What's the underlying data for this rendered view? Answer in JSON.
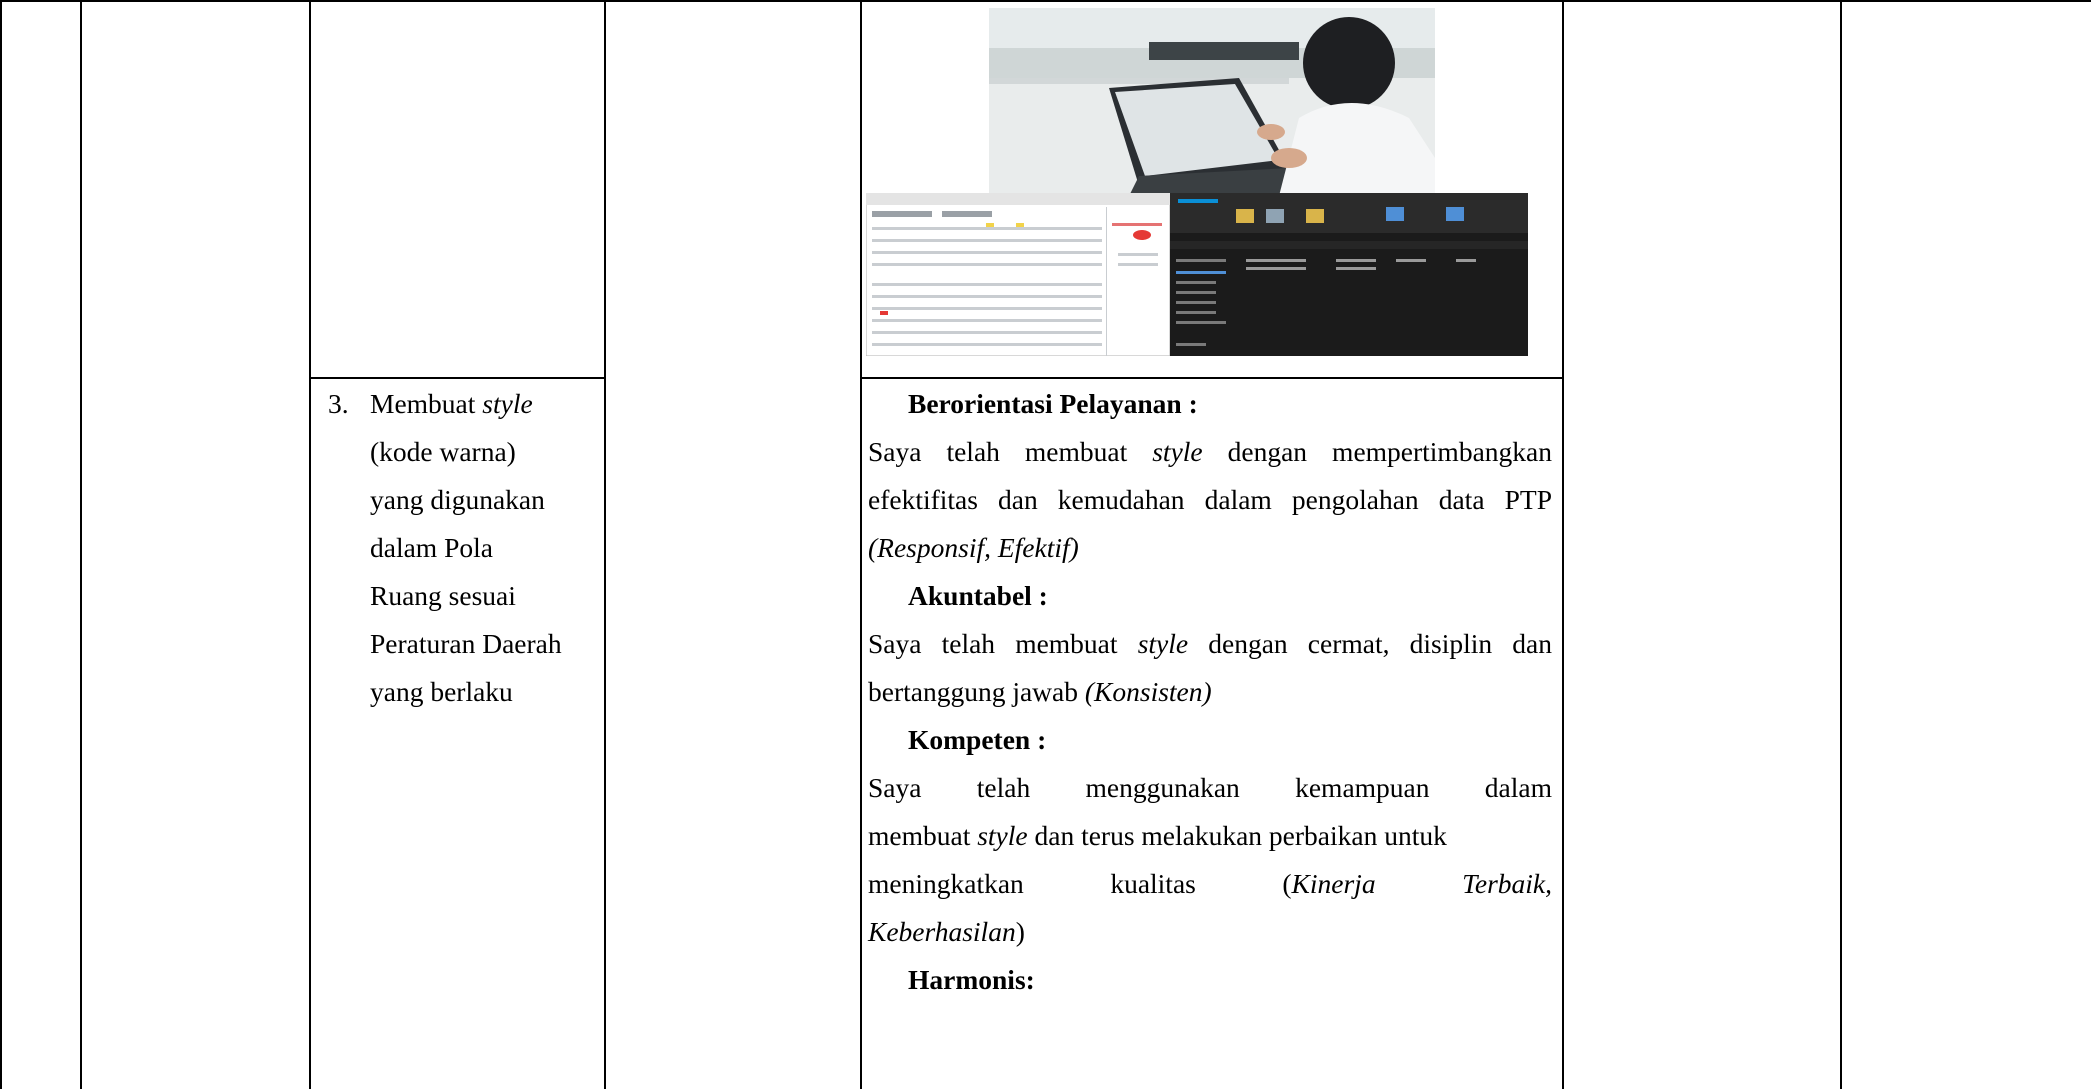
{
  "left_cell": {
    "item_number": "3.",
    "lines": [
      {
        "text": "Membuat ",
        "italic": "style"
      },
      {
        "text": "(kode warna)"
      },
      {
        "text": "yang digunakan"
      },
      {
        "text": "dalam Pola"
      },
      {
        "text": "Ruang sesuai"
      },
      {
        "text": "Peraturan Daerah"
      },
      {
        "text": "yang berlaku"
      }
    ]
  },
  "right_cell": {
    "sections": [
      {
        "heading": "Berorientasi Pelayanan :",
        "para_pre": "Saya telah membuat ",
        "para_italic": "style",
        "para_mid": " dengan mempertimbangkan efektifitas dan kemudahan dalam pengolahan data PTP ",
        "para_tag": "(Responsif, Efektif)"
      },
      {
        "heading": "Akuntabel :",
        "para_pre": "Saya telah membuat ",
        "para_italic": "style",
        "para_mid": " dengan cermat, disiplin dan bertanggung jawab ",
        "para_tag": "(Konsisten)"
      },
      {
        "heading": "Kompeten :",
        "line1": "Saya telah menggunakan kemampuan dalam",
        "line2_italic": "style",
        "line2_pre": "membuat ",
        "line2_post": " dan terus melakukan perbaikan untuk",
        "line3_a": "meningkatkan",
        "line3_b": "kualitas",
        "line3_c": "(",
        "line3_d": "Kinerja",
        "line3_e": "Terbaik,",
        "line4_italic": "Keberhasilan",
        "line4_post": ")"
      },
      {
        "heading": "Harmonis:"
      }
    ]
  },
  "colors": {
    "border": "#000000",
    "background": "#ffffff",
    "highlight": "#e53935"
  }
}
